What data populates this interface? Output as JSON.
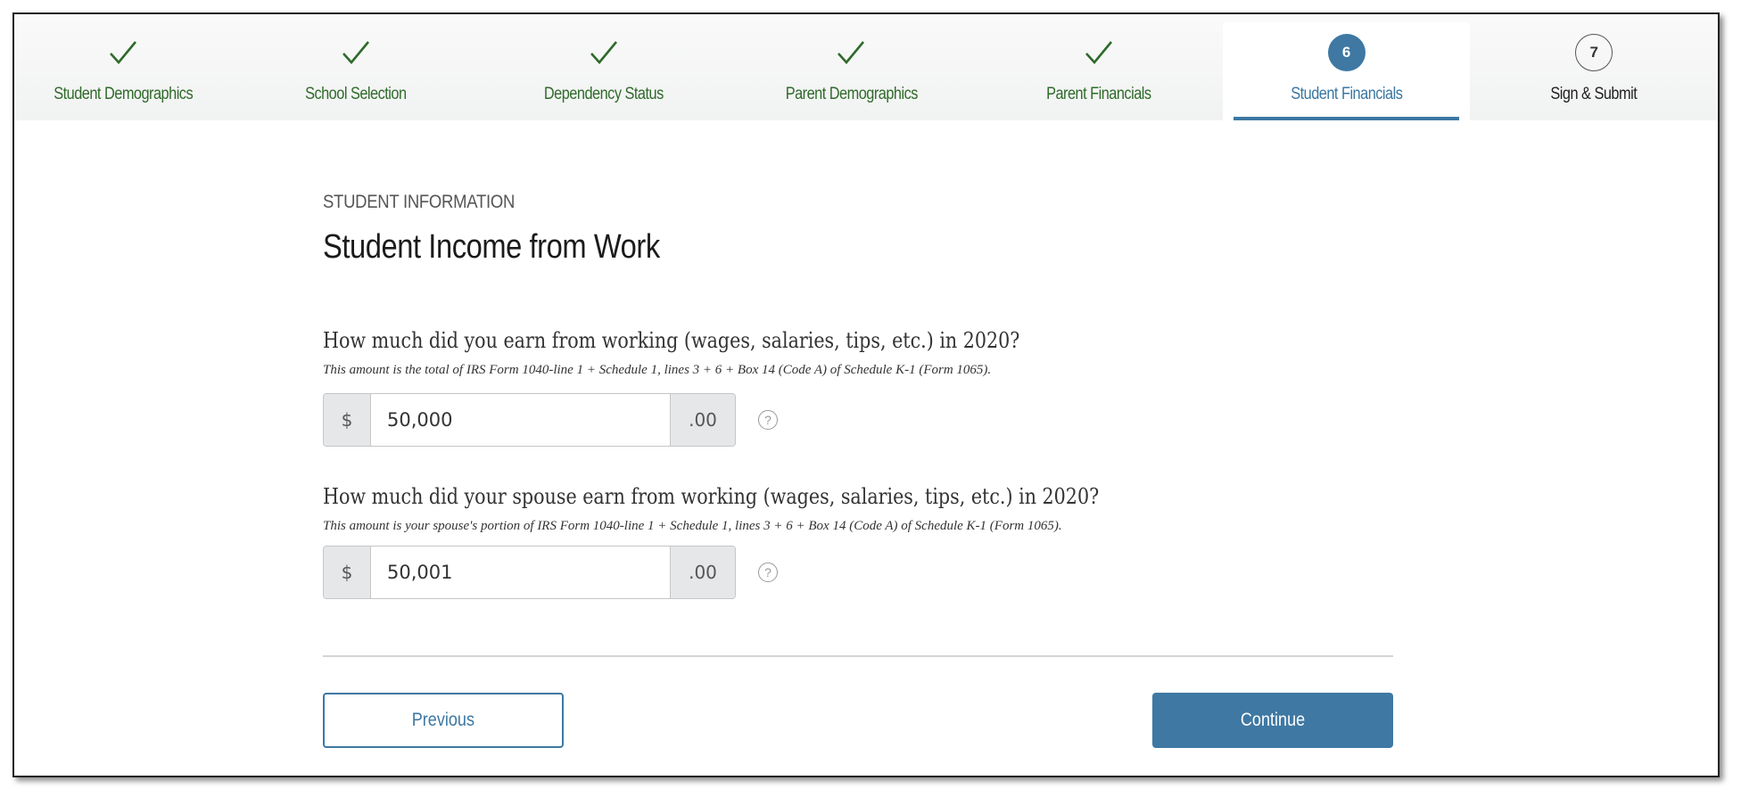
{
  "stepper": {
    "steps": [
      {
        "label": "Student Demographics",
        "status": "complete",
        "icon": "check-icon"
      },
      {
        "label": "School Selection",
        "status": "complete",
        "icon": "check-icon"
      },
      {
        "label": "Dependency Status",
        "status": "complete",
        "icon": "check-icon"
      },
      {
        "label": "Parent Demographics",
        "status": "complete",
        "icon": "check-icon"
      },
      {
        "label": "Parent Financials",
        "status": "complete",
        "icon": "check-icon"
      },
      {
        "label": "Student Financials",
        "status": "active",
        "number": "6"
      },
      {
        "label": "Sign & Submit",
        "status": "pending",
        "number": "7"
      }
    ]
  },
  "page": {
    "eyebrow": "STUDENT INFORMATION",
    "title": "Student Income from Work"
  },
  "questions": [
    {
      "question": "How much did you earn from working (wages, salaries, tips, etc.) in 2020?",
      "hint": "This amount is the total of IRS Form 1040-line 1 + Schedule 1, lines 3 + 6 + Box 14 (Code A) of Schedule K-1 (Form 1065).",
      "prefix": "$",
      "value": "50,000",
      "suffix": ".00",
      "help": "?"
    },
    {
      "question": "How much did your spouse earn from working (wages, salaries, tips, etc.) in 2020?",
      "hint": "This amount is your spouse's portion of IRS Form 1040-line 1 + Schedule 1, lines 3 + 6 + Box 14 (Code A) of Schedule K-1 (Form 1065).",
      "prefix": "$",
      "value": "50,001",
      "suffix": ".00",
      "help": "?"
    }
  ],
  "buttons": {
    "previous": "Previous",
    "continue": "Continue"
  },
  "colors": {
    "accent": "#3e78a3",
    "complete": "#2f6a2a"
  }
}
